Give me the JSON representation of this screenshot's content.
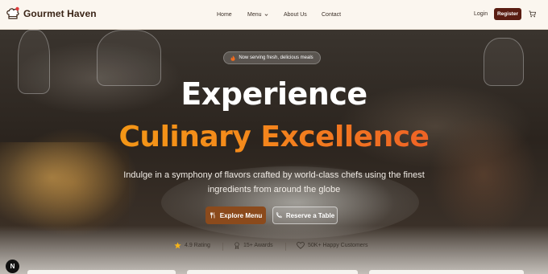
{
  "brand": {
    "name": "Gourmet Haven",
    "icon": "chef-hat-icon"
  },
  "nav": {
    "links": [
      "Home",
      "Menu",
      "About Us",
      "Contact"
    ],
    "login": "Login",
    "register": "Register",
    "cart_icon": "cart-icon"
  },
  "hero": {
    "badge": "Now serving fresh, delicious meals",
    "headline_line1": "Experience",
    "headline_line2": "Culinary Excellence",
    "subtitle": "Indulge in a symphony of flavors crafted by world-class chefs using the finest ingredients from around the globe",
    "primary_cta": "Explore Menu",
    "secondary_cta": "Reserve a Table",
    "stats": [
      {
        "icon": "star-icon",
        "label": "4.9 Rating"
      },
      {
        "icon": "award-icon",
        "label": "15+ Awards"
      },
      {
        "icon": "heart-icon",
        "label": "50K+ Happy Customers"
      }
    ]
  },
  "footer_badge": "N",
  "colors": {
    "accent": "#5a1d12",
    "cta": "#8b4a1c",
    "gradient_start": "#f5a312",
    "gradient_end": "#ec4a2c"
  }
}
